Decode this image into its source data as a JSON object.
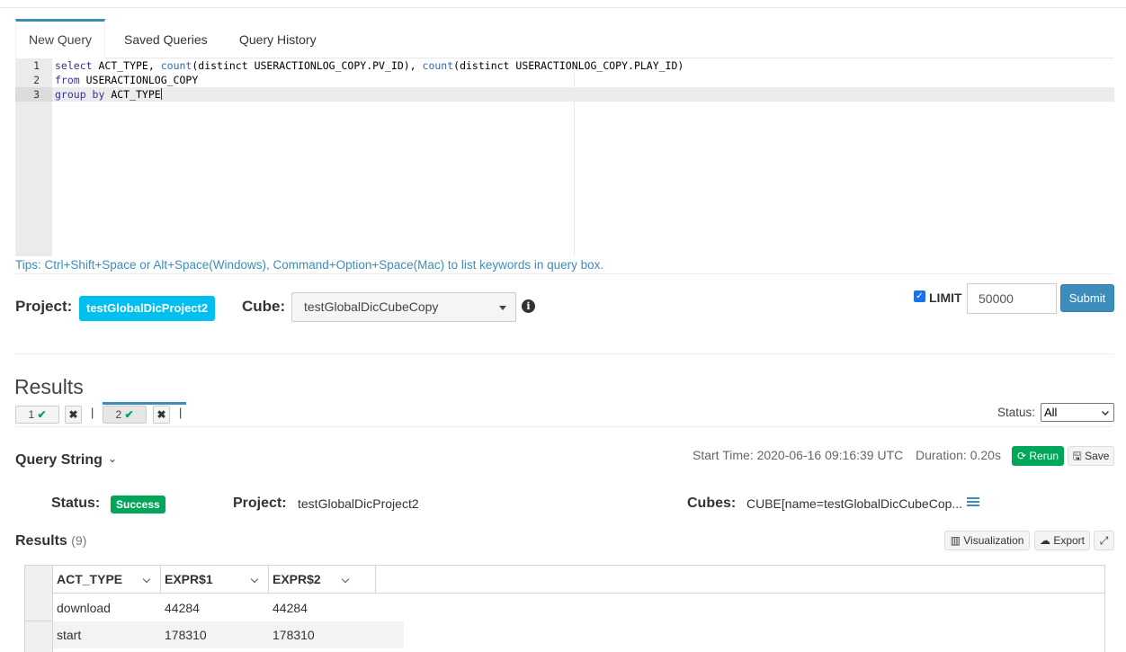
{
  "tabs": [
    "New Query",
    "Saved Queries",
    "Query History"
  ],
  "editor": {
    "line_numbers": [
      "1",
      "2",
      "3"
    ],
    "lines": [
      [
        {
          "t": "kw",
          "v": "select"
        },
        {
          "t": "",
          "v": " ACT_TYPE, "
        },
        {
          "t": "fn",
          "v": "count"
        },
        {
          "t": "",
          "v": "(distinct USERACTIONLOG_COPY.PV_ID), "
        },
        {
          "t": "fn",
          "v": "count"
        },
        {
          "t": "",
          "v": "(distinct USERACTIONLOG_COPY.PLAY_ID)"
        }
      ],
      [
        {
          "t": "kw",
          "v": "from"
        },
        {
          "t": "",
          "v": " USERACTIONLOG_COPY"
        }
      ],
      [
        {
          "t": "kw",
          "v": "group by"
        },
        {
          "t": "",
          "v": " ACT_TYPE"
        }
      ]
    ]
  },
  "tips": "Tips: Ctrl+Shift+Space or Alt+Space(Windows), Command+Option+Space(Mac) to list keywords in query box.",
  "project": {
    "label": "Project:",
    "value": "testGlobalDicProject2"
  },
  "cube": {
    "label": "Cube:",
    "value": "testGlobalDicCubeCopy",
    "info_icon": "info-circle-icon"
  },
  "limit": {
    "label": "LIMIT",
    "checked": true,
    "value": "50000"
  },
  "submit_label": "Submit",
  "results_title": "Results",
  "result_tabs": [
    {
      "label": "1",
      "icon": "check-icon"
    },
    {
      "label": "2",
      "icon": "check-icon",
      "active": true
    }
  ],
  "separator": "|",
  "close_glyph": "✖",
  "status_filter": {
    "label": "Status:",
    "selected": "All"
  },
  "query_string": {
    "label": "Query String",
    "chevron": "⌄"
  },
  "meta": {
    "start_time": "Start Time: 2020-06-16 09:16:39 UTC",
    "duration": "Duration: 0.20s"
  },
  "rerun_label": "Rerun",
  "save_label": "Save",
  "info": {
    "status_label": "Status:",
    "status_value": "Success",
    "project_label": "Project:",
    "project_value": "testGlobalDicProject2",
    "cubes_label": "Cubes:",
    "cubes_value": "CUBE[name=testGlobalDicCubeCop..."
  },
  "results_section": {
    "label": "Results",
    "count": "(9)"
  },
  "visualization_label": "Visualization",
  "export_label": "Export",
  "grid": {
    "columns": [
      "ACT_TYPE",
      "EXPR$1",
      "EXPR$2"
    ],
    "rows": [
      [
        "download",
        "44284",
        "44284"
      ],
      [
        "start",
        "178310",
        "178310"
      ]
    ]
  },
  "colors": {
    "accent": "#3c8dbc",
    "success": "#00a65a",
    "info": "#00c0ef"
  }
}
